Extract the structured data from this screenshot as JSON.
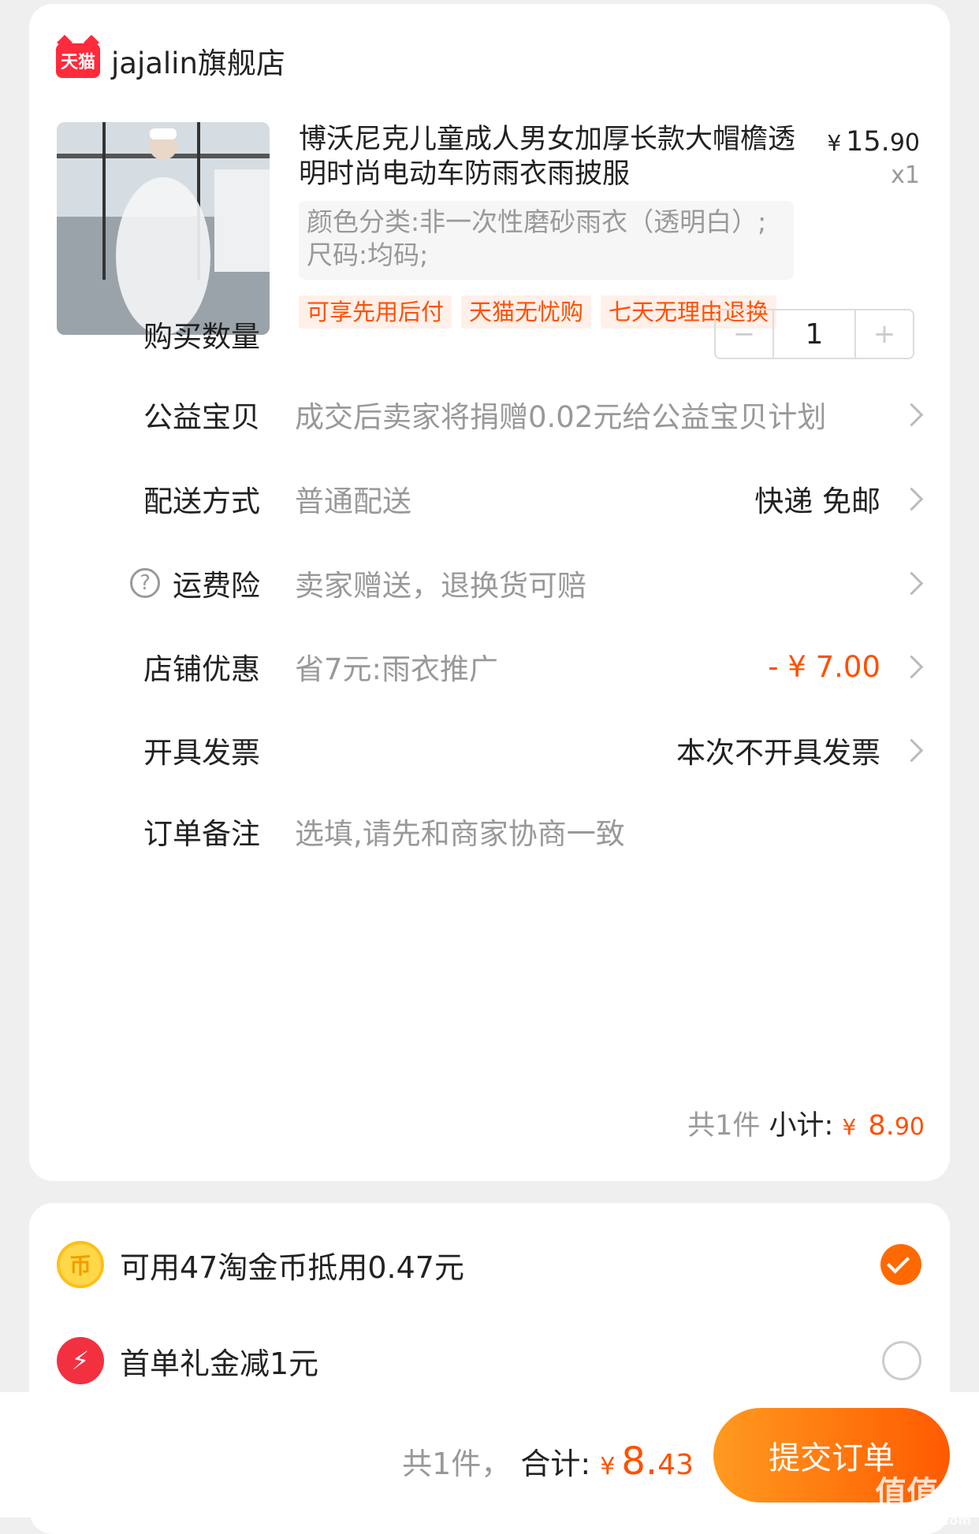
{
  "store": {
    "badge": "天猫",
    "name": "jajalin旗舰店"
  },
  "product": {
    "title": "博沃尼克儿童成人男女加厚长款大帽檐透明时尚电动车防雨衣雨披服",
    "price_currency": "¥",
    "price_int": "15.",
    "price_dec": "90",
    "quantity_mark": "x1",
    "sku": "颜色分类:非一次性磨砂雨衣（透明白）;尺码:均码;",
    "tags": [
      "可享先用后付",
      "天猫无忧购",
      "七天无理由退换"
    ]
  },
  "rows": {
    "quantity": {
      "label": "购买数量",
      "value": "1",
      "minus": "−",
      "plus": "+"
    },
    "charity": {
      "label": "公益宝贝",
      "desc": "成交后卖家将捐赠0.02元给公益宝贝计划"
    },
    "delivery": {
      "label": "配送方式",
      "desc": "普通配送",
      "value": "快递 免邮"
    },
    "insurance": {
      "label": "运费险",
      "desc": "卖家赠送，退换货可赔",
      "icon": "?"
    },
    "discount": {
      "label": "店铺优惠",
      "desc": "省7元:雨衣推广",
      "value": "- ¥ 7.00"
    },
    "invoice": {
      "label": "开具发票",
      "value": "本次不开具发票"
    },
    "note": {
      "label": "订单备注",
      "placeholder": "选填,请先和商家协商一致"
    }
  },
  "subtotal": {
    "count_text": "共1件",
    "label": "小计:",
    "currency": "¥",
    "int": " 8.",
    "dec": "90"
  },
  "options": {
    "coins": {
      "icon": "币",
      "label": "可用47淘金币抵用0.47元",
      "checked": true
    },
    "first_order": {
      "icon": "⚡",
      "label": "首单礼金减1元",
      "checked": false
    }
  },
  "footer": {
    "count_text": "共1件，",
    "label": "合计:",
    "currency": "¥",
    "int": "8.",
    "dec": "43",
    "submit_label": "提交订单",
    "watermark": "值值值",
    "watermark_sub": "zhizhizhi.com"
  },
  "colors": {
    "accent": "#ff5000",
    "button_start": "#ff9a1f",
    "button_end": "#ff5a00",
    "tmall_red": "#ff2a3b"
  }
}
